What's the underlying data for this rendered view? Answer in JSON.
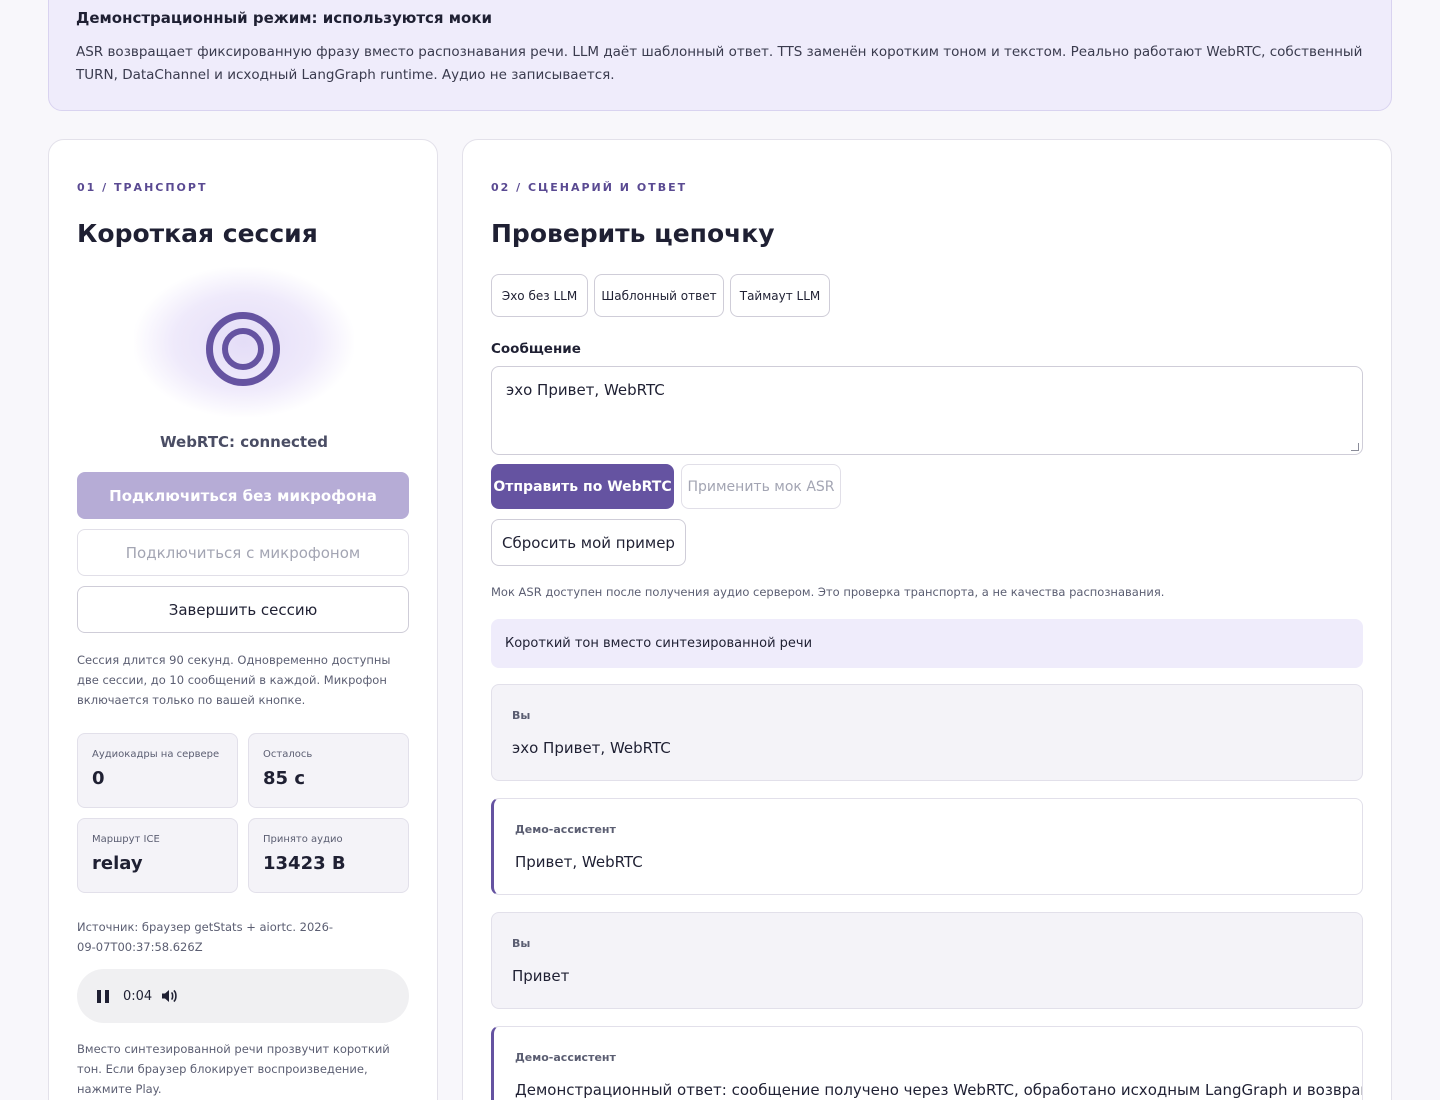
{
  "banner": {
    "title": "Демонстрационный режим: используются моки",
    "text": "ASR возвращает фиксированную фразу вместо распознавания речи. LLM даёт шаблонный ответ. TTS заменён коротким тоном и текстом. Реально работают WebRTC, собственный TURN, DataChannel и исходный LangGraph runtime. Аудио не записывается."
  },
  "transport": {
    "eyebrow": "01 / ТРАНСПОРТ",
    "title": "Короткая сессия",
    "status": "WebRTC: connected",
    "connect_no_mic": "Подключиться без микрофона",
    "connect_mic": "Подключиться с микрофоном",
    "end_session": "Завершить сессию",
    "session_note": "Сессия длится 90 секунд. Одновременно доступны две сессии, до 10 сообщений в каждой. Микрофон включается только по вашей кнопке.",
    "stats": [
      {
        "label": "Аудиокадры на сервере",
        "value": "0"
      },
      {
        "label": "Осталось",
        "value": "85 с"
      },
      {
        "label": "Маршрут ICE",
        "value": "relay"
      },
      {
        "label": "Принято аудио",
        "value": "13423 B"
      }
    ],
    "source_note": "Источник: браузер getStats + aiortc. 2026-09-07T00:37:58.626Z",
    "player": {
      "time": "0:04",
      "play_icon": "pause-icon",
      "volume_icon": "volume-icon"
    },
    "playback_note": "Вместо синтезированной речи прозвучит короткий тон. Если браузер блокирует воспроизведение, нажмите Play."
  },
  "scenario": {
    "eyebrow": "02 / СЦЕНАРИЙ И ОТВЕТ",
    "title": "Проверить цепочку",
    "chips": [
      "Эхо без LLM",
      "Шаблонный ответ",
      "Таймаут LLM"
    ],
    "message_label": "Сообщение",
    "message_value": "эхо Привет, WebRTC",
    "send_button": "Отправить по WebRTC",
    "asr_button": "Применить мок ASR",
    "reset_button": "Сбросить мой пример",
    "hint": "Мок ASR доступен после получения аудио сервером. Это проверка транспорта, а не качества распознавания.",
    "info": "Короткий тон вместо синтезированной речи",
    "messages": [
      {
        "role": "Вы",
        "text": "эхо Привет, WebRTC"
      },
      {
        "role": "Демо-ассистент",
        "text": "Привет, WebRTC"
      },
      {
        "role": "Вы",
        "text": "Привет"
      },
      {
        "role": "Демо-ассистент",
        "text": "Демонстрационный ответ: сообщение получено через WebRTC, обработано исходным LangGraph и возвращено по"
      }
    ]
  },
  "colors": {
    "accent": "#6553a1",
    "accent_soft": "#efecfb",
    "disabled_accent": "#b6acd6"
  }
}
